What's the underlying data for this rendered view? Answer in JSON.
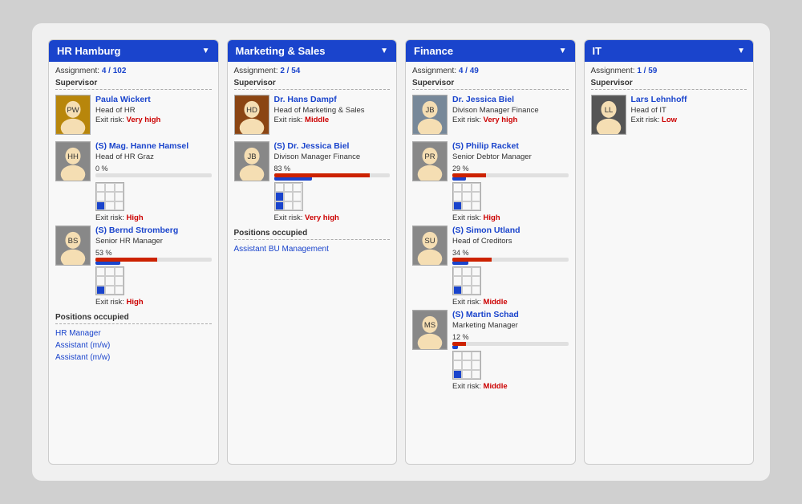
{
  "columns": [
    {
      "id": "hr-hamburg",
      "title": "HR Hamburg",
      "assignment": "4 / 102",
      "supervisor_label": "Supervisor",
      "supervisor": {
        "name": "Paula Wickert",
        "title": "Head of HR",
        "exit_risk_label": "Exit risk:",
        "exit_risk": "Very high",
        "photo_color": "#b8860b"
      },
      "succession": [
        {
          "name": "(S) Mag. Hanne Hamsel",
          "title": "Head of HR Graz",
          "progress_pct": 0,
          "progress_label": "0 %",
          "exit_risk": "High",
          "grid_filled": [
            7
          ]
        },
        {
          "name": "(S) Bernd Stromberg",
          "title": "Senior HR Manager",
          "progress_pct": 53,
          "progress_label": "53 %",
          "exit_risk": "High",
          "grid_filled": [
            7
          ]
        }
      ],
      "positions_occupied_label": "Positions occupied",
      "positions": [
        "HR Manager",
        "Assistant (m/w)",
        "Assistant (m/w)"
      ]
    },
    {
      "id": "marketing-sales",
      "title": "Marketing & Sales",
      "assignment": "2 / 54",
      "supervisor_label": "Supervisor",
      "supervisor": {
        "name": "Dr. Hans Dampf",
        "title": "Head of Marketing & Sales",
        "exit_risk_label": "Exit risk:",
        "exit_risk": "Middle",
        "photo_color": "#8b4513"
      },
      "succession": [
        {
          "name": "(S) Dr. Jessica Biel",
          "title": "Divison Manager Finance",
          "progress_pct": 83,
          "progress_label": "83 %",
          "exit_risk": "Very high",
          "grid_filled": [
            4,
            7
          ]
        }
      ],
      "positions_occupied_label": "Positions occupied",
      "positions": [
        "Assistant BU Management"
      ]
    },
    {
      "id": "finance",
      "title": "Finance",
      "assignment": "4 / 49",
      "supervisor_label": "Supervisor",
      "supervisor": {
        "name": "Dr. Jessica Biel",
        "title": "Divison Manager Finance",
        "exit_risk_label": "Exit risk:",
        "exit_risk": "Very high",
        "photo_color": "#778899"
      },
      "succession": [
        {
          "name": "(S) Philip Racket",
          "title": "Senior Debtor Manager",
          "progress_pct": 29,
          "progress_label": "29 %",
          "exit_risk": "High",
          "grid_filled": [
            7
          ]
        },
        {
          "name": "(S) Simon Utland",
          "title": "Head of Creditors",
          "progress_pct": 34,
          "progress_label": "34 %",
          "exit_risk": "Middle",
          "grid_filled": [
            7
          ]
        },
        {
          "name": "(S) Martin Schad",
          "title": "Marketing Manager",
          "progress_pct": 12,
          "progress_label": "12 %",
          "exit_risk": "Middle",
          "grid_filled": [
            7
          ]
        }
      ],
      "positions_occupied_label": null,
      "positions": []
    },
    {
      "id": "it",
      "title": "IT",
      "assignment": "1 / 59",
      "supervisor_label": "Supervisor",
      "supervisor": {
        "name": "Lars Lehnhoff",
        "title": "Head of IT",
        "exit_risk_label": "Exit risk:",
        "exit_risk": "Low",
        "photo_color": "#555"
      },
      "succession": [],
      "positions_occupied_label": null,
      "positions": []
    }
  ]
}
